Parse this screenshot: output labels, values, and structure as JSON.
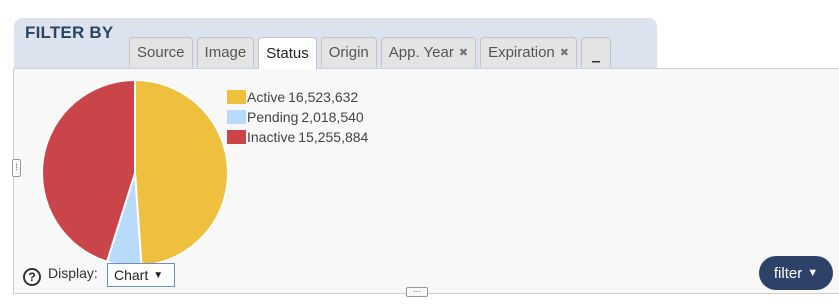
{
  "filter_by_title": "FILTER BY",
  "tabs": [
    {
      "label": "Source",
      "active": false,
      "removable": false
    },
    {
      "label": "Image",
      "active": false,
      "removable": false
    },
    {
      "label": "Status",
      "active": true,
      "removable": false
    },
    {
      "label": "Origin",
      "active": false,
      "removable": false
    },
    {
      "label": "App. Year",
      "active": false,
      "removable": true
    },
    {
      "label": "Expiration",
      "active": false,
      "removable": true
    }
  ],
  "tab_remove_glyph": "✖",
  "more_tabs_glyph": "▁",
  "chart_data": {
    "type": "pie",
    "slices": [
      {
        "label": "Active",
        "value": 16523632,
        "value_text": "16,523,632",
        "color": "#efbf3e"
      },
      {
        "label": "Pending",
        "value": 2018540,
        "value_text": "2,018,540",
        "color": "#b9dafa"
      },
      {
        "label": "Inactive",
        "value": 15255884,
        "value_text": "15,255,884",
        "color": "#c9454a"
      }
    ],
    "legend_position": "right"
  },
  "display": {
    "help_glyph": "?",
    "label": "Display:",
    "selected": "Chart",
    "caret": "▼"
  },
  "filter_button": {
    "label": "filter",
    "icon": "funnel-icon",
    "icon_glyph": "▼"
  },
  "colors": {
    "header_band": "#dde3ee",
    "title": "#2c4564",
    "filter_button": "#2e4169",
    "select_border": "#6b8fc2"
  }
}
